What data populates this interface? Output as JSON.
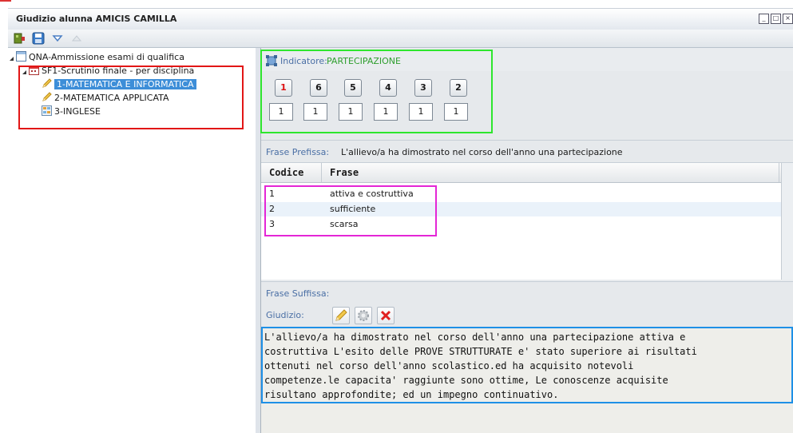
{
  "window": {
    "title": "Giudizio alunna AMICIS CAMILLA",
    "controls": [
      "minimize-icon",
      "maximize-icon",
      "close-icon"
    ]
  },
  "toolbar": {
    "buttons": [
      {
        "icon": "exit-door-icon"
      },
      {
        "icon": "save-disk-icon"
      },
      {
        "icon": "triangle-down-icon"
      },
      {
        "icon": "triangle-up-icon"
      }
    ]
  },
  "tree": {
    "root": "QNA-Ammissione esami di qualifica",
    "group": "SF1-Scrutinio finale - per disciplina",
    "items": [
      {
        "label": "1-MATEMATICA E INFORMATICA",
        "icon": "pencil-icon",
        "selected": true
      },
      {
        "label": "2-MATEMATICA APPLICATA",
        "icon": "pencil-icon",
        "selected": false
      },
      {
        "label": "3-INGLESE",
        "icon": "grid-icon",
        "selected": false
      }
    ]
  },
  "indicatore": {
    "label": "Indicatore:",
    "value": "PARTECIPAZIONE",
    "buttons": [
      "1",
      "6",
      "5",
      "4",
      "3",
      "2"
    ],
    "values": [
      "1",
      "1",
      "1",
      "1",
      "1",
      "1"
    ]
  },
  "frase_prefissa": {
    "label": "Frase Prefissa:",
    "value": "L'allievo/a ha dimostrato nel corso dell'anno una partecipazione"
  },
  "grid": {
    "columns": [
      "Codice",
      "Frase"
    ],
    "rows": [
      {
        "codice": "1",
        "frase": "attiva e costruttiva"
      },
      {
        "codice": "2",
        "frase": "sufficiente"
      },
      {
        "codice": "3",
        "frase": "scarsa"
      }
    ]
  },
  "frase_suffissa": {
    "label": "Frase Suffissa:"
  },
  "giudizio": {
    "label": "Giudizio:",
    "buttons": [
      "pencil-icon",
      "gear-icon",
      "delete-x-icon"
    ],
    "text": "L'allievo/a ha dimostrato nel corso dell'anno una partecipazione attiva e\ncostruttiva L'esito delle PROVE STRUTTURATE e' stato superiore ai risultati\nottenuti nel corso dell'anno scolastico.ed ha acquisito notevoli\ncompetenze.le capacita' raggiunte sono ottime, Le conoscenze acquisite\nrisultano approfondite; ed un impegno continuativo."
  },
  "colors": {
    "highlight_red": "#e21616",
    "highlight_green": "#2ee62e",
    "highlight_magenta": "#e426d6",
    "highlight_blue": "#1e90e6",
    "selection": "#3d8ed8"
  }
}
